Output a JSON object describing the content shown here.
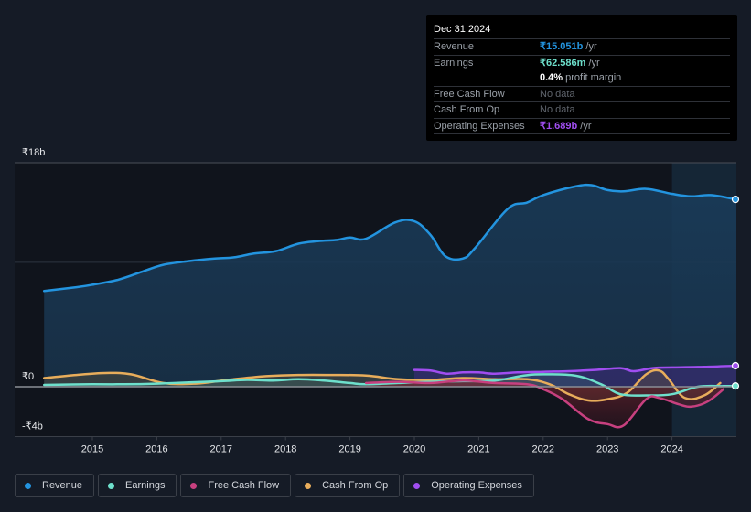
{
  "tooltip": {
    "date": "Dec 31 2024",
    "rows": [
      {
        "key": "Revenue",
        "value": "₹15.051b",
        "suffix": " /yr",
        "color": "#2394df"
      },
      {
        "key": "Earnings",
        "value": "₹62.586m",
        "suffix": " /yr",
        "color": "#6ee0cc"
      },
      {
        "key": "",
        "value": "0.4%",
        "suffix": " profit margin",
        "color": "#ffffff"
      },
      {
        "key": "Free Cash Flow",
        "value": "No data",
        "suffix": "",
        "color": "#5f646c"
      },
      {
        "key": "Cash From Op",
        "value": "No data",
        "suffix": "",
        "color": "#5f646c"
      },
      {
        "key": "Operating Expenses",
        "value": "₹1.689b",
        "suffix": " /yr",
        "color": "#a04ef0"
      }
    ]
  },
  "legend": [
    {
      "label": "Revenue",
      "color": "#2394df"
    },
    {
      "label": "Earnings",
      "color": "#6ee0cc"
    },
    {
      "label": "Free Cash Flow",
      "color": "#c7407f"
    },
    {
      "label": "Cash From Op",
      "color": "#e8ad5b"
    },
    {
      "label": "Operating Expenses",
      "color": "#a04ef0"
    }
  ],
  "chart_data": {
    "type": "area",
    "title": "",
    "xlabel": "",
    "ylabel": "",
    "currency": "₹",
    "ylim": [
      -4,
      18
    ],
    "xlim": [
      2014.25,
      2025.0
    ],
    "y_tick_labels": [
      {
        "value": 18,
        "label": "₹18b"
      },
      {
        "value": 0,
        "label": "₹0"
      },
      {
        "value": -4,
        "label": "-₹4b"
      }
    ],
    "gridlines": [
      18,
      10,
      0
    ],
    "x_tick_labels": [
      "2015",
      "2016",
      "2017",
      "2018",
      "2019",
      "2020",
      "2021",
      "2022",
      "2023",
      "2024"
    ],
    "x_ticks": [
      2015,
      2016,
      2017,
      2018,
      2019,
      2020,
      2021,
      2022,
      2023,
      2024
    ],
    "highlight_range": [
      2024.0,
      2025.0
    ],
    "series": [
      {
        "name": "Revenue",
        "color": "#2394df",
        "unit": "b",
        "x": [
          2014.25,
          2014.75,
          2015.0,
          2015.4,
          2015.8,
          2016.1,
          2016.5,
          2016.9,
          2017.2,
          2017.5,
          2017.85,
          2018.2,
          2018.5,
          2018.8,
          2019.0,
          2019.25,
          2019.7,
          2020.0,
          2020.25,
          2020.48,
          2020.75,
          2020.95,
          2021.45,
          2021.75,
          2022.0,
          2022.5,
          2022.75,
          2023.0,
          2023.25,
          2023.6,
          2024.0,
          2024.3,
          2024.6,
          2025.0
        ],
        "values": [
          7.7,
          8.0,
          8.2,
          8.6,
          9.3,
          9.8,
          10.1,
          10.3,
          10.4,
          10.7,
          10.9,
          11.5,
          11.7,
          11.8,
          12.0,
          11.9,
          13.2,
          13.3,
          12.2,
          10.5,
          10.3,
          11.2,
          14.3,
          14.8,
          15.4,
          16.1,
          16.2,
          15.8,
          15.7,
          15.9,
          15.5,
          15.3,
          15.4,
          15.05
        ]
      },
      {
        "name": "Earnings",
        "color": "#6ee0cc",
        "unit": "b",
        "x": [
          2014.25,
          2015.0,
          2015.5,
          2016.0,
          2016.5,
          2017.0,
          2017.4,
          2017.8,
          2018.2,
          2018.6,
          2019.0,
          2019.25,
          2019.75,
          2020.25,
          2020.75,
          2021.25,
          2021.7,
          2022.0,
          2022.5,
          2022.9,
          2023.2,
          2023.6,
          2024.0,
          2024.4,
          2024.8,
          2025.0
        ],
        "values": [
          0.15,
          0.2,
          0.2,
          0.25,
          0.35,
          0.45,
          0.55,
          0.5,
          0.6,
          0.5,
          0.3,
          0.2,
          0.3,
          0.4,
          0.45,
          0.5,
          0.9,
          1.0,
          0.9,
          0.2,
          -0.6,
          -0.7,
          -0.6,
          0.0,
          0.05,
          0.063
        ]
      },
      {
        "name": "Free Cash Flow",
        "color": "#c7407f",
        "unit": "b",
        "x": [
          2019.25,
          2019.75,
          2020.25,
          2020.75,
          2021.25,
          2021.75,
          2022.0,
          2022.3,
          2022.7,
          2023.0,
          2023.25,
          2023.6,
          2023.8,
          2024.1,
          2024.3,
          2024.55,
          2024.8
        ],
        "values": [
          0.3,
          0.4,
          0.3,
          0.5,
          0.3,
          0.2,
          -0.2,
          -1.0,
          -2.6,
          -3.0,
          -3.1,
          -1.0,
          -0.9,
          -1.4,
          -1.6,
          -1.2,
          -0.2
        ]
      },
      {
        "name": "Cash From Op",
        "color": "#e8ad5b",
        "unit": "b",
        "x": [
          2014.25,
          2014.75,
          2015.2,
          2015.6,
          2016.1,
          2016.6,
          2017.1,
          2017.7,
          2018.2,
          2018.7,
          2019.25,
          2019.75,
          2020.25,
          2020.75,
          2021.25,
          2021.75,
          2022.1,
          2022.4,
          2022.7,
          2023.0,
          2023.3,
          2023.6,
          2023.8,
          2023.95,
          2024.2,
          2024.5,
          2024.75
        ],
        "values": [
          0.7,
          0.95,
          1.1,
          1.0,
          0.3,
          0.25,
          0.55,
          0.85,
          0.95,
          0.95,
          0.9,
          0.6,
          0.55,
          0.7,
          0.6,
          0.6,
          0.2,
          -0.6,
          -1.1,
          -1.0,
          -0.5,
          1.0,
          1.3,
          0.6,
          -0.9,
          -0.7,
          0.3
        ]
      },
      {
        "name": "Operating Expenses",
        "color": "#a04ef0",
        "unit": "b",
        "x": [
          2020.0,
          2020.25,
          2020.5,
          2020.75,
          2021.0,
          2021.25,
          2021.6,
          2022.0,
          2022.4,
          2022.8,
          2023.2,
          2023.4,
          2023.7,
          2024.0,
          2024.5,
          2025.0
        ],
        "values": [
          1.35,
          1.3,
          1.05,
          1.15,
          1.15,
          1.05,
          1.15,
          1.2,
          1.25,
          1.35,
          1.5,
          1.25,
          1.5,
          1.55,
          1.6,
          1.69
        ]
      }
    ],
    "end_markers": [
      "Revenue",
      "Earnings",
      "Operating Expenses"
    ]
  }
}
